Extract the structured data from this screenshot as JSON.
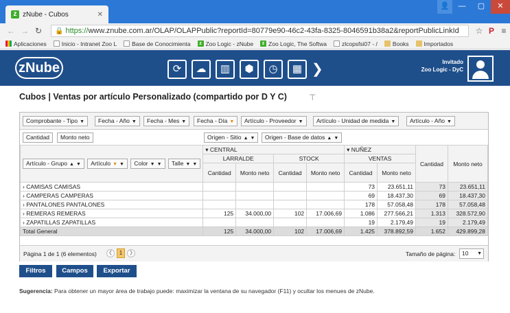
{
  "browser": {
    "tab_title": "zNube - Cubos",
    "url_https": "https://",
    "url_rest": "www.znube.com.ar/OLAP/OLAPPublic?reportId=80779e90-46c2-43fa-8325-8046591b38a2&reportPublicLinkId",
    "bookmarks": [
      "Aplicaciones",
      "Inicio - Intranet Zoo L",
      "Base de Conocimienta",
      "Zoo Logic - zNube",
      "Zoo Logic, The Softwa",
      "zlcopsfsi07 - /",
      "Books",
      "Importados"
    ]
  },
  "header": {
    "logo": "zNube",
    "user_line1": "Invitado",
    "user_line2": "Zoo Logic - DyC"
  },
  "page": {
    "title": "Cubos | Ventas por artículo Personalizado (compartido por D Y C)"
  },
  "pivot": {
    "filters": [
      "Comprobante - Tipo",
      "Fecha - Año",
      "Fecha - Mes",
      "Fecha - Día",
      "Artículo - Proveedor",
      "Artículo - Unidad de medida",
      "Artículo - Año"
    ],
    "data_fields": [
      "Cantidad",
      "Monto neto"
    ],
    "column_fields": [
      "Origen - Sitio",
      "Origen - Base de datos"
    ],
    "row_fields": [
      "Artículo - Grupo",
      "Artículo",
      "Color",
      "Talle"
    ],
    "col_groups": {
      "central": "CENTRAL",
      "nunez": "NUÑEZ",
      "larralde": "LARRALDE",
      "stock": "STOCK",
      "ventas": "VENTAS"
    },
    "measure_headers": [
      "Cantidad",
      "Monto neto"
    ],
    "rows": [
      {
        "label": "CAMISAS CAMISAS",
        "v": [
          "",
          "",
          "",
          "",
          "73",
          "23.651,11",
          "73",
          "23.651,11"
        ]
      },
      {
        "label": "CAMPERAS CAMPERAS",
        "v": [
          "",
          "",
          "",
          "",
          "69",
          "18.437,30",
          "69",
          "18.437,30"
        ]
      },
      {
        "label": "PANTALONES PANTALONES",
        "v": [
          "",
          "",
          "",
          "",
          "178",
          "57.058,48",
          "178",
          "57.058,48"
        ]
      },
      {
        "label": "REMERAS REMERAS",
        "v": [
          "125",
          "34.000,00",
          "102",
          "17.006,69",
          "1.086",
          "277.566,21",
          "1.313",
          "328.572,90"
        ]
      },
      {
        "label": "ZAPATILLAS ZAPATILLAS",
        "v": [
          "",
          "",
          "",
          "",
          "19",
          "2.179,49",
          "19",
          "2.179,49"
        ]
      }
    ],
    "total": {
      "label": "Total General",
      "v": [
        "125",
        "34.000,00",
        "102",
        "17.006,69",
        "1.425",
        "378.892,59",
        "1.652",
        "429.899,28"
      ]
    },
    "pager_text": "Página 1 de 1 (6 elementos)",
    "current_page": "1",
    "page_size_label": "Tamaño de página:",
    "page_size": "10"
  },
  "buttons": {
    "filters": "Filtros",
    "fields": "Campos",
    "export": "Exportar"
  },
  "hint": {
    "label": "Sugerencia:",
    "text": "Para obtener un mayor área de trabajo puede: maximizar la ventana de su navegador (F11) y ocultar los menues de zNube."
  }
}
